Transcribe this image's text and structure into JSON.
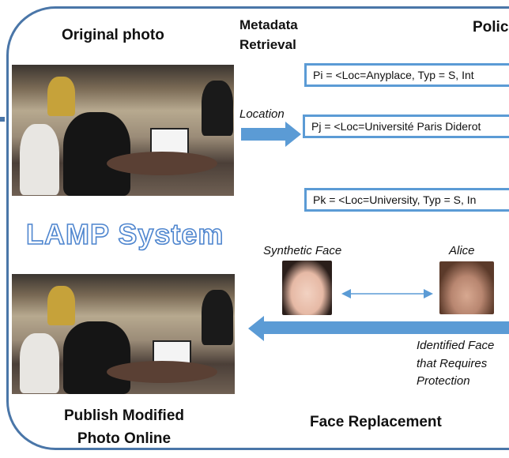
{
  "title": "LAMP System",
  "left": {
    "original_label": "Original photo",
    "published_label_line1": "Publish Modified",
    "published_label_line2": "Photo Online"
  },
  "metadata": {
    "line1": "Metadata",
    "line2": "Retrieval",
    "arrow_label": "Location"
  },
  "policy": {
    "heading": "Polic",
    "items": [
      "Pi = <Loc=Anyplace, Typ = S, Int",
      "Pj = <Loc=Université Paris Diderot",
      "Pk = <Loc=University, Typ = S, In"
    ]
  },
  "faces": {
    "synthetic_label": "Synthetic Face",
    "alice_label": "Alice",
    "identified_line1": "Identified Face",
    "identified_line2": "that Requires",
    "identified_line3": "Protection",
    "section_label": "Face Replacement"
  },
  "colors": {
    "frame": "#4a76a8",
    "arrow": "#5b9bd5",
    "title_outline": "#4f86cf"
  }
}
